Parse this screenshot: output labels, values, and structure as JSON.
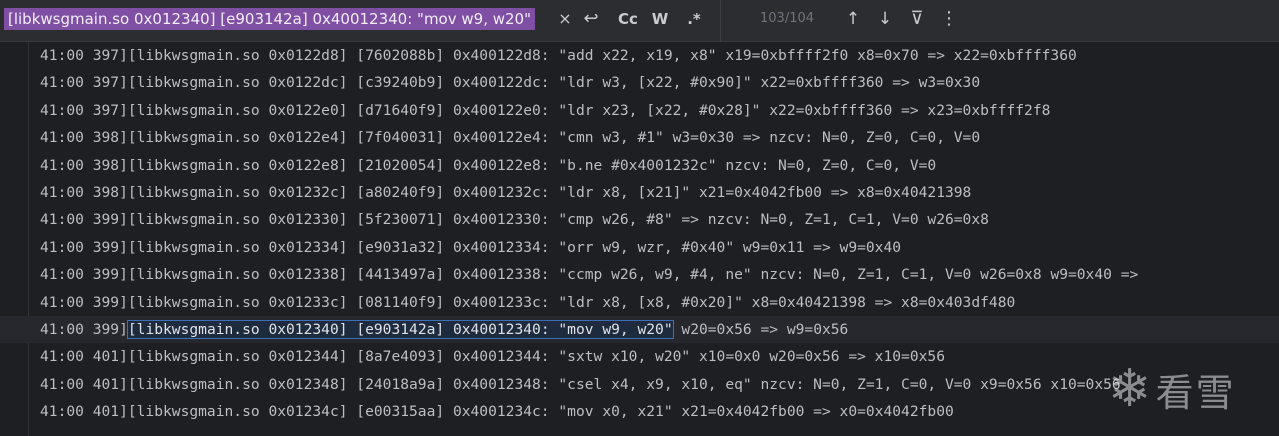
{
  "search": {
    "query": "[libkwsgmain.so 0x012340] [e903142a] 0x40012340: \"mov w9, w20\"",
    "close_glyph": "×",
    "replace_glyph": "↩",
    "match_case": "Cc",
    "whole_word": "W",
    "regex": ".*",
    "match_counter": "103/104",
    "prev_glyph": "↑",
    "next_glyph": "↓",
    "filter_glyph": "⊽",
    "more_glyph": "⋮"
  },
  "log": {
    "lines": [
      {
        "text": "41:00 397][libkwsgmain.so 0x0122d8] [7602088b] 0x400122d8: \"add x22, x19, x8\" x19=0xbffff2f0 x8=0x70 => x22=0xbffff360"
      },
      {
        "text": "41:00 397][libkwsgmain.so 0x0122dc] [c39240b9] 0x400122dc: \"ldr w3, [x22, #0x90]\" x22=0xbffff360 => w3=0x30"
      },
      {
        "text": "41:00 397][libkwsgmain.so 0x0122e0] [d71640f9] 0x400122e0: \"ldr x23, [x22, #0x28]\" x22=0xbffff360 => x23=0xbffff2f8"
      },
      {
        "text": "41:00 398][libkwsgmain.so 0x0122e4] [7f040031] 0x400122e4: \"cmn w3, #1\" w3=0x30 => nzcv: N=0, Z=0, C=0, V=0"
      },
      {
        "text": "41:00 398][libkwsgmain.so 0x0122e8] [21020054] 0x400122e8: \"b.ne #0x4001232c\" nzcv: N=0, Z=0, C=0, V=0"
      },
      {
        "text": "41:00 398][libkwsgmain.so 0x01232c] [a80240f9] 0x4001232c: \"ldr x8, [x21]\" x21=0x4042fb00 => x8=0x40421398"
      },
      {
        "text": "41:00 399][libkwsgmain.so 0x012330] [5f230071] 0x40012330: \"cmp w26, #8\" => nzcv: N=0, Z=1, C=1, V=0 w26=0x8"
      },
      {
        "text": "41:00 399][libkwsgmain.so 0x012334] [e9031a32] 0x40012334: \"orr w9, wzr, #0x40\" w9=0x11 => w9=0x40"
      },
      {
        "text": "41:00 399][libkwsgmain.so 0x012338] [4413497a] 0x40012338: \"ccmp w26, w9, #4, ne\" nzcv: N=0, Z=1, C=1, V=0 w26=0x8 w9=0x40 =>"
      },
      {
        "text": "41:00 399][libkwsgmain.so 0x01233c] [081140f9] 0x4001233c: \"ldr x8, [x8, #0x20]\" x8=0x40421398 => x8=0x403df480"
      }
    ],
    "current": {
      "prefix": "41:00 399]",
      "match": "[libkwsgmain.so 0x012340] [e903142a] 0x40012340: \"mov w9, w20\"",
      "suffix": " w20=0x56 => w9=0x56"
    },
    "lines_after": [
      {
        "text": "41:00 401][libkwsgmain.so 0x012344] [8a7e4093] 0x40012344: \"sxtw x10, w20\" x10=0x0 w20=0x56 => x10=0x56"
      },
      {
        "text": "41:00 401][libkwsgmain.so 0x012348] [24018a9a] 0x40012348: \"csel x4, x9, x10, eq\" nzcv: N=0, Z=1, C=0, V=0 x9=0x56 x10=0x56"
      },
      {
        "text": "41:00 401][libkwsgmain.so 0x01234c] [e00315aa] 0x4001234c: \"mov x0, x21\" x21=0x4042fb00 => x0=0x4042fb00"
      }
    ]
  },
  "watermark": {
    "icon": "snowflake-icon",
    "glyph": "❄",
    "text": "看雪"
  }
}
